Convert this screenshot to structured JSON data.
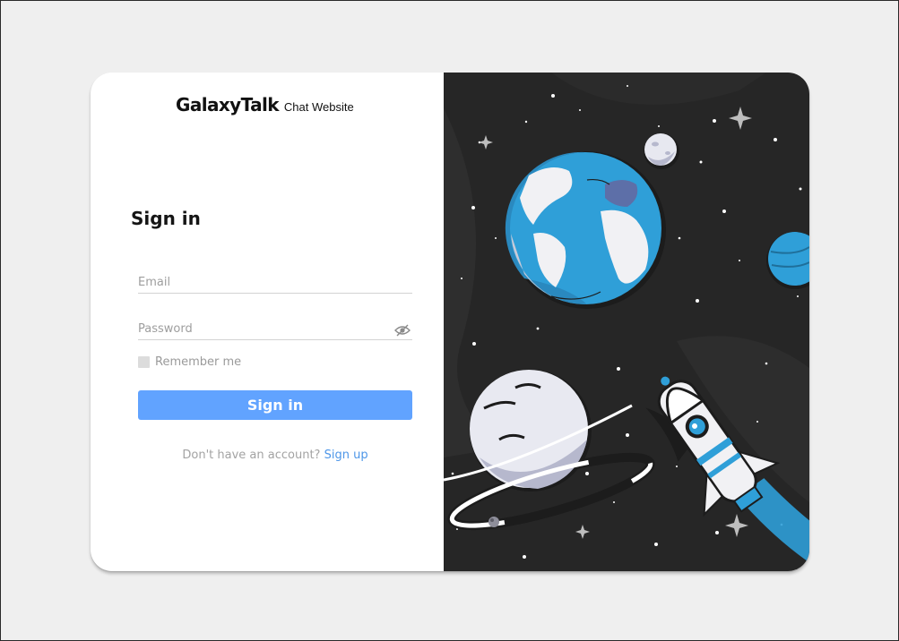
{
  "brand": {
    "name": "GalaxyTalk",
    "subtitle": "Chat Website"
  },
  "signin": {
    "title": "Sign in",
    "email_placeholder": "Email",
    "password_placeholder": "Password",
    "remember_label": "Remember me",
    "remember_checked": false,
    "button_label": "Sign in"
  },
  "signup": {
    "prompt": "Don't have an account?",
    "link_label": "Sign up"
  },
  "colors": {
    "accent": "#61a3ff",
    "link": "#4d96e8",
    "illustration_bg": "#262626",
    "planet_blue": "#2f9fd8"
  },
  "icons": {
    "password_toggle": "eye-slash-icon"
  }
}
